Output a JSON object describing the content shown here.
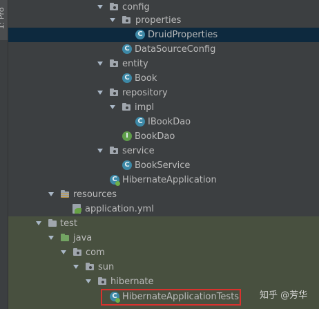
{
  "sidebar": {
    "tab_label": "1: Pro"
  },
  "tree": {
    "rows": [
      {
        "label": "config",
        "kind": "package",
        "expanded": true
      },
      {
        "label": "properties",
        "kind": "package",
        "expanded": true
      },
      {
        "label": "DruidProperties",
        "kind": "class",
        "selected": true
      },
      {
        "label": "DataSourceConfig",
        "kind": "class"
      },
      {
        "label": "entity",
        "kind": "package",
        "expanded": true
      },
      {
        "label": "Book",
        "kind": "class"
      },
      {
        "label": "repository",
        "kind": "package",
        "expanded": true
      },
      {
        "label": "impl",
        "kind": "package",
        "expanded": true
      },
      {
        "label": "IBookDao",
        "kind": "class"
      },
      {
        "label": "BookDao",
        "kind": "interface"
      },
      {
        "label": "service",
        "kind": "package",
        "expanded": true
      },
      {
        "label": "BookService",
        "kind": "class"
      },
      {
        "label": "HibernateApplication",
        "kind": "spring-boot-class"
      },
      {
        "label": "resources",
        "kind": "resources-folder",
        "expanded": true
      },
      {
        "label": "application.yml",
        "kind": "yml-file"
      },
      {
        "label": "test",
        "kind": "folder",
        "expanded": true
      },
      {
        "label": "java",
        "kind": "test-source-folder",
        "expanded": true
      },
      {
        "label": "com",
        "kind": "package",
        "expanded": true
      },
      {
        "label": "sun",
        "kind": "package",
        "expanded": true
      },
      {
        "label": "hibernate",
        "kind": "package",
        "expanded": true
      },
      {
        "label": "HibernateApplicationTests",
        "kind": "spring-boot-class",
        "highlighted": true
      }
    ]
  },
  "icons": {
    "class_glyph": "C",
    "interface_glyph": "I"
  },
  "watermark": {
    "text": "知乎 @芳华"
  },
  "colors": {
    "background": "#3c3f41",
    "selection": "#0d293e",
    "test_background": "#48503f",
    "highlight_border": "#d9322e",
    "class_icon": "#3d89a7",
    "interface_icon": "#5f9e4a"
  }
}
